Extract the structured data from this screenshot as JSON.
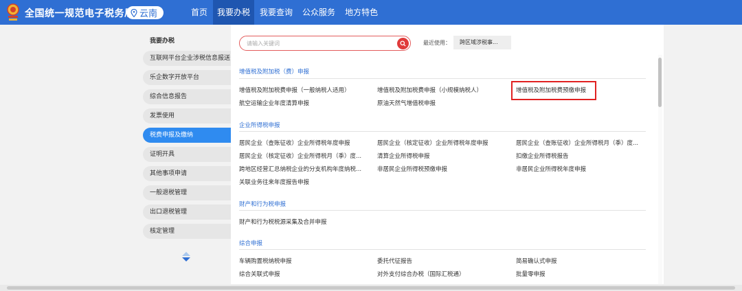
{
  "header": {
    "site_title": "全国统一规范电子税务局",
    "region": "云南",
    "nav": [
      "首页",
      "我要办税",
      "我要查询",
      "公众服务",
      "地方特色"
    ],
    "active_nav": "我要办税"
  },
  "sidebar": {
    "title": "我要办税",
    "items": [
      "互联网平台企业涉税信息报送",
      "乐企数字开放平台",
      "综合信息报告",
      "发票使用",
      "税费申报及缴纳",
      "证明开具",
      "其他事项申请",
      "一般退税管理",
      "出口退税管理",
      "核定管理"
    ],
    "active_item": "税费申报及缴纳"
  },
  "search": {
    "placeholder": "请输入关键词",
    "recent_label": "最近使用：",
    "recent_item": "跨区域涉税事..."
  },
  "sections": [
    {
      "title": "增值税及附加税（费）申报",
      "links": [
        "增值税及附加税费申报（一般纳税人适用）",
        "增值税及附加税费申报（小规模纳税人）",
        "增值税及附加税费预缴申报",
        "航空运输企业年度清算申报",
        "原油天然气增值税申报"
      ]
    },
    {
      "title": "企业所得税申报",
      "links": [
        "居民企业（查账征收）企业所得税年度申报",
        "居民企业（核定征收）企业所得税年度申报",
        "居民企业（查账征收）企业所得税月（季）度...",
        "居民企业（核定征收）企业所得税月（季）度...",
        "清算企业所得税申报",
        "扣缴企业所得税报告",
        "跨地区经营汇总纳税企业的分支机构年度纳税...",
        "非居民企业所得税预缴申报",
        "非居民企业所得税年度申报",
        "关联业务往来年度报告申报"
      ]
    },
    {
      "title": "财产和行为税申报",
      "links": [
        "财产和行为税税源采集及合并申报"
      ]
    },
    {
      "title": "综合申报",
      "links": [
        "车辆购置税纳税申报",
        "委托代征报告",
        "简易确认式申报",
        "综合关联式申报",
        "对外支付综合办税（国际汇税通）",
        "批量零申报"
      ]
    }
  ],
  "colors": {
    "header_bg": "#2f6fd3",
    "active_nav_bg": "#1f56b0",
    "active_sidebar": "#2f8bf0",
    "section_title": "#2f6fd3",
    "highlight": "#e02020"
  }
}
